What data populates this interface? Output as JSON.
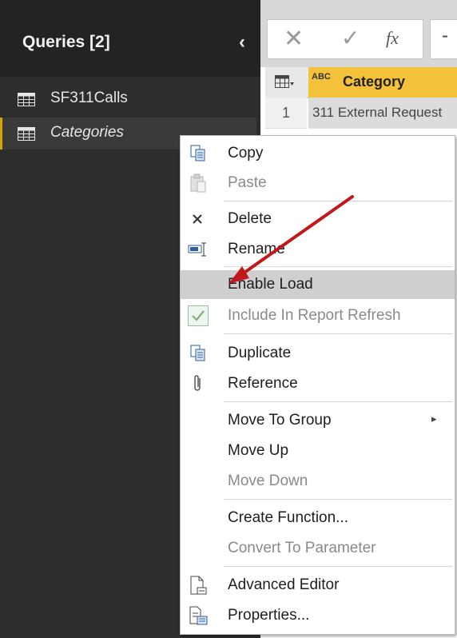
{
  "queries_pane": {
    "title": "Queries [2]",
    "collapse_glyph": "‹",
    "items": [
      {
        "label": "SF311Calls",
        "icon": "table-icon",
        "selected": false
      },
      {
        "label": "Categories",
        "icon": "table-icon",
        "selected": true
      }
    ]
  },
  "formula_bar": {
    "cancel_glyph": "✕",
    "commit_glyph": "✓",
    "fx_glyph": "fx",
    "expand_glyph": "-"
  },
  "grid": {
    "column_type_icon": "ABC",
    "column_header": "Category",
    "rows": [
      {
        "num": "1",
        "value": "311 External Request"
      }
    ]
  },
  "context_menu": {
    "items": [
      {
        "label": "Copy",
        "icon": "copy-icon",
        "disabled": false
      },
      {
        "label": "Paste",
        "icon": "paste-icon",
        "disabled": true
      },
      {
        "label": "Delete",
        "icon": "delete-icon",
        "disabled": false
      },
      {
        "label": "Rename",
        "icon": "rename-icon",
        "disabled": false
      },
      {
        "label": "Enable Load",
        "icon": "",
        "disabled": false,
        "highlighted": true
      },
      {
        "label": "Include In Report Refresh",
        "icon": "checkmark-icon",
        "disabled": true
      },
      {
        "label": "Duplicate",
        "icon": "duplicate-icon",
        "disabled": false
      },
      {
        "label": "Reference",
        "icon": "paperclip-icon",
        "disabled": false
      },
      {
        "label": "Move To Group",
        "icon": "",
        "disabled": false,
        "submenu": true
      },
      {
        "label": "Move Up",
        "icon": "",
        "disabled": false
      },
      {
        "label": "Move Down",
        "icon": "",
        "disabled": true
      },
      {
        "label": "Create Function...",
        "icon": "",
        "disabled": false
      },
      {
        "label": "Convert To Parameter",
        "icon": "",
        "disabled": true
      },
      {
        "label": "Advanced Editor",
        "icon": "advanced-editor-icon",
        "disabled": false
      },
      {
        "label": "Properties...",
        "icon": "properties-icon",
        "disabled": false
      }
    ],
    "submenu_glyph": "▸"
  },
  "colors": {
    "pane_bg": "#2d2d2d",
    "selection_accent": "#d8a400",
    "column_header_bg": "#f3c13a",
    "highlight_bg": "#cfcfcf",
    "annotation_arrow": "#c0181b"
  }
}
